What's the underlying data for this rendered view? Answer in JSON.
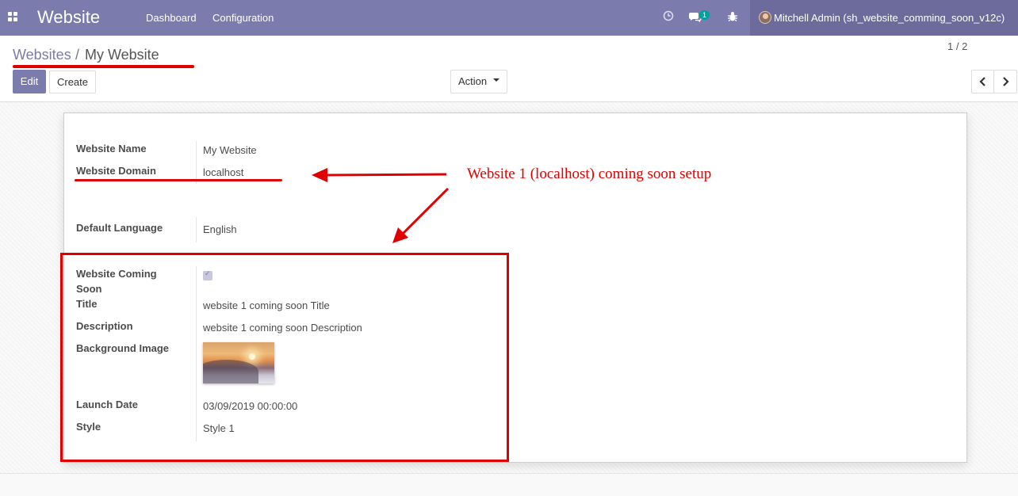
{
  "navbar": {
    "app_title": "Website",
    "menu": [
      "Dashboard",
      "Configuration"
    ],
    "icons": [
      "apps-icon",
      "clock-icon",
      "chat-icon",
      "bug-icon"
    ],
    "chat_badge": "1",
    "user_name": "Mitchell Admin (sh_website_comming_soon_v12c)",
    "color": "#7c7bad"
  },
  "breadcrumb": {
    "parent": "Websites",
    "separator": "/",
    "current": "My Website"
  },
  "buttons": {
    "edit": "Edit",
    "create": "Create",
    "action": "Action"
  },
  "pager": {
    "value": "1 / 2"
  },
  "form": {
    "website_name": {
      "label": "Website Name",
      "value": "My Website"
    },
    "website_domain": {
      "label": "Website Domain",
      "value": "localhost"
    },
    "default_language": {
      "label": "Default Language",
      "value": "English"
    },
    "coming_soon": {
      "label_line1": "Website Coming",
      "label_line2": "Soon",
      "checked": true
    },
    "title": {
      "label": "Title",
      "value": "website 1 coming soon Title"
    },
    "description": {
      "label": "Description",
      "value": "website 1 coming soon Description"
    },
    "background_image": {
      "label": "Background Image"
    },
    "launch_date": {
      "label": "Launch Date",
      "value": "03/09/2019 00:00:00"
    },
    "style": {
      "label": "Style",
      "value": "Style 1"
    }
  },
  "annotation": {
    "text": "Website 1 (localhost) coming soon setup",
    "color": "#e00000"
  }
}
